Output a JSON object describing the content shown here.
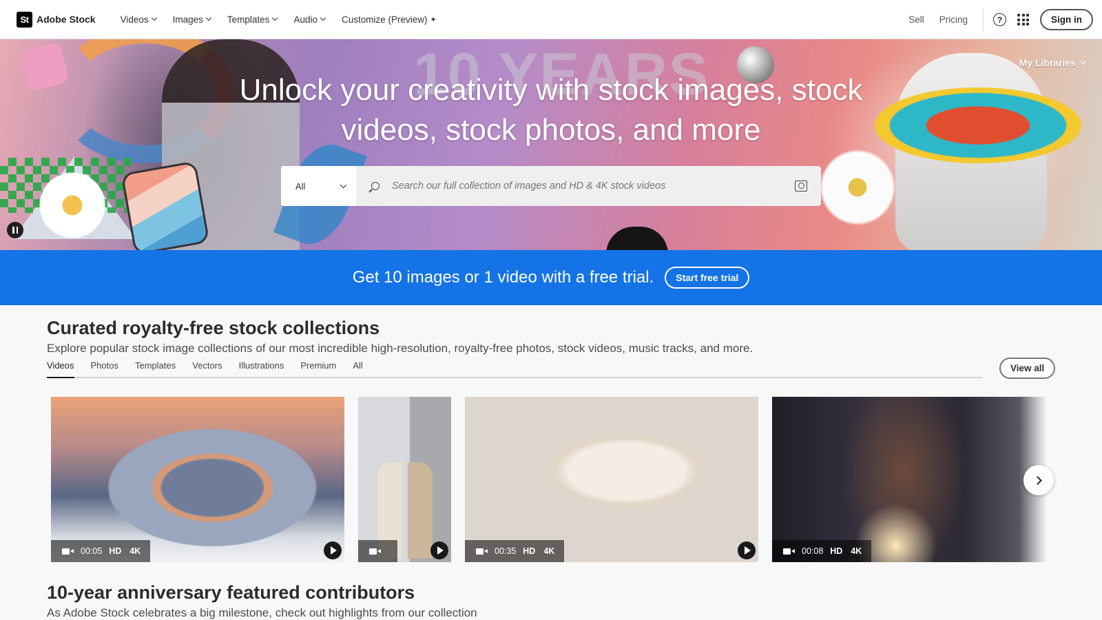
{
  "nav": {
    "logo_text": "St",
    "brand": "Adobe Stock",
    "menu": [
      {
        "label": "Videos"
      },
      {
        "label": "Images"
      },
      {
        "label": "Templates"
      },
      {
        "label": "Audio"
      },
      {
        "label": "Customize (Preview)"
      }
    ],
    "sell": "Sell",
    "pricing": "Pricing",
    "help_glyph": "?",
    "signin": "Sign in"
  },
  "hero": {
    "background_text": "10 YEARS",
    "title": "Unlock your creativity with stock images, stock videos, stock photos, and more",
    "my_libraries": "My Libraries",
    "search": {
      "type_selected": "All",
      "placeholder": "Search our full collection of images and HD & 4K stock videos"
    }
  },
  "trial": {
    "text": "Get 10 images or 1 video with a free trial.",
    "button": "Start free trial",
    "color": "#1473e6"
  },
  "collections": {
    "title": "Curated royalty-free stock collections",
    "description": "Explore popular stock image collections of our most incredible high-resolution, royalty-free photos, stock videos, music tracks, and more.",
    "tabs": [
      "Videos",
      "Photos",
      "Templates",
      "Vectors",
      "Illustrations",
      "Premium",
      "All"
    ],
    "active_tab": "Videos",
    "view_all": "View all",
    "items": [
      {
        "duration": "00:05",
        "hd": "HD",
        "uhd": "4K"
      },
      {
        "duration": "",
        "hd": "",
        "uhd": ""
      },
      {
        "duration": "00:35",
        "hd": "HD",
        "uhd": "4K"
      },
      {
        "duration": "00:08",
        "hd": "HD",
        "uhd": "4K"
      }
    ]
  },
  "contributors": {
    "title": "10-year anniversary featured contributors",
    "description": "As Adobe Stock celebrates a big milestone, check out highlights from our collection"
  }
}
